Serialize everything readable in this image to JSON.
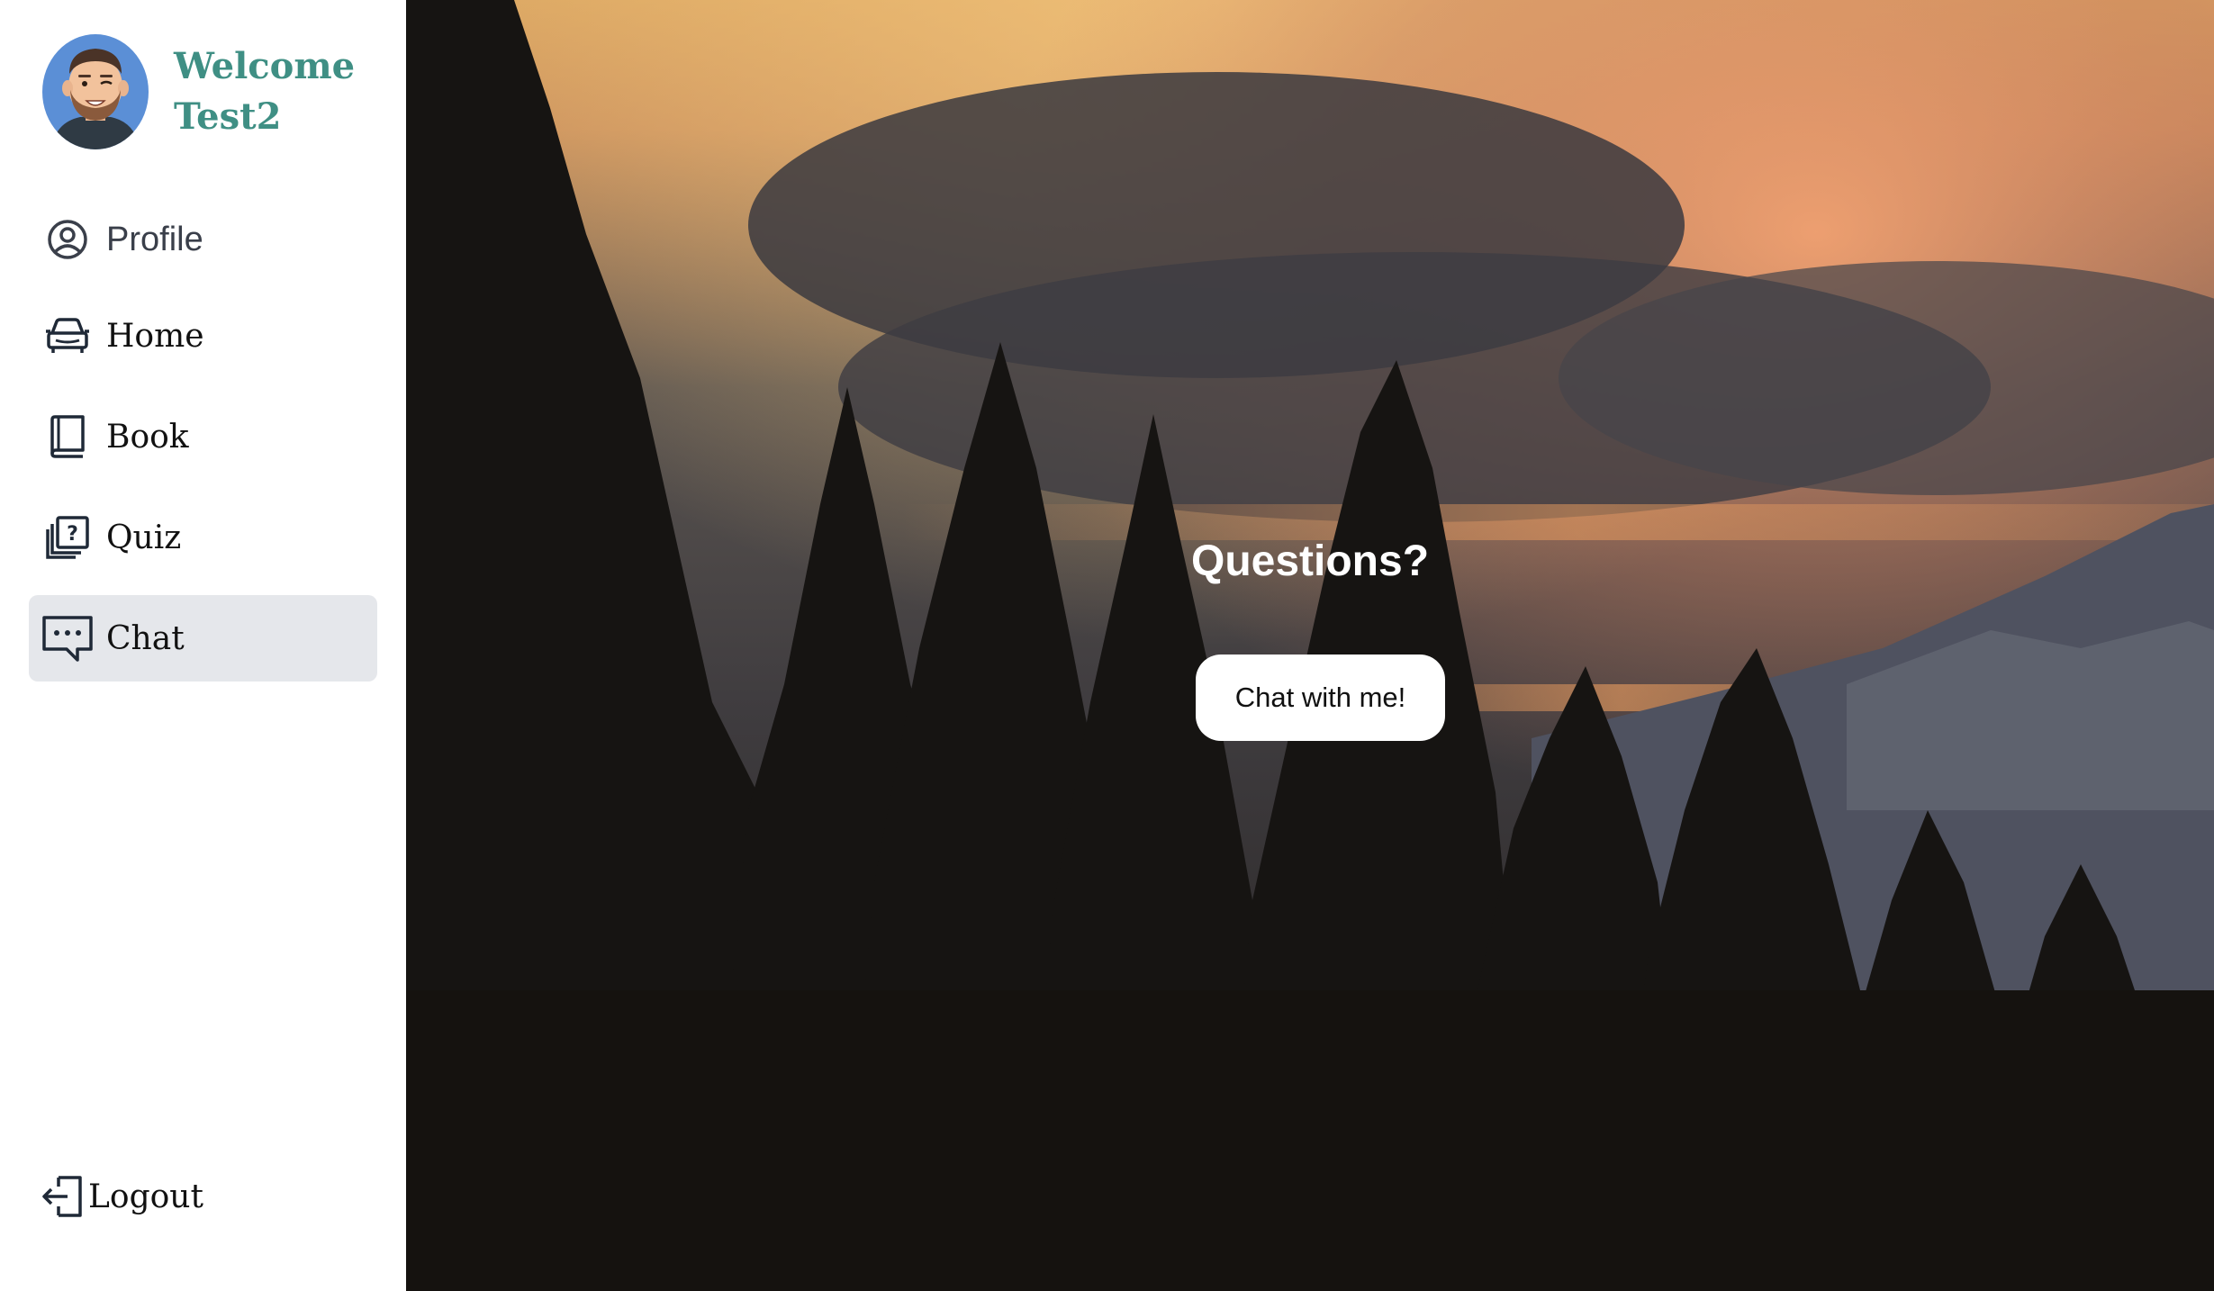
{
  "user": {
    "welcome_line1": "Welcome",
    "welcome_line2": "Test2"
  },
  "nav": {
    "items": [
      {
        "label": "Profile",
        "icon": "user-circle-icon",
        "active": false
      },
      {
        "label": "Home",
        "icon": "car-icon",
        "active": false
      },
      {
        "label": "Book",
        "icon": "book-icon",
        "active": false
      },
      {
        "label": "Quiz",
        "icon": "quiz-question-icon",
        "active": false
      },
      {
        "label": "Chat",
        "icon": "chat-bubble-icon",
        "active": true
      }
    ],
    "logout_label": "Logout"
  },
  "hero": {
    "title": "Questions?",
    "button_label": "Chat with me!"
  },
  "colors": {
    "accent": "#3f8f84",
    "active_bg": "#e5e7eb",
    "sidebar_bg": "#ffffff"
  }
}
